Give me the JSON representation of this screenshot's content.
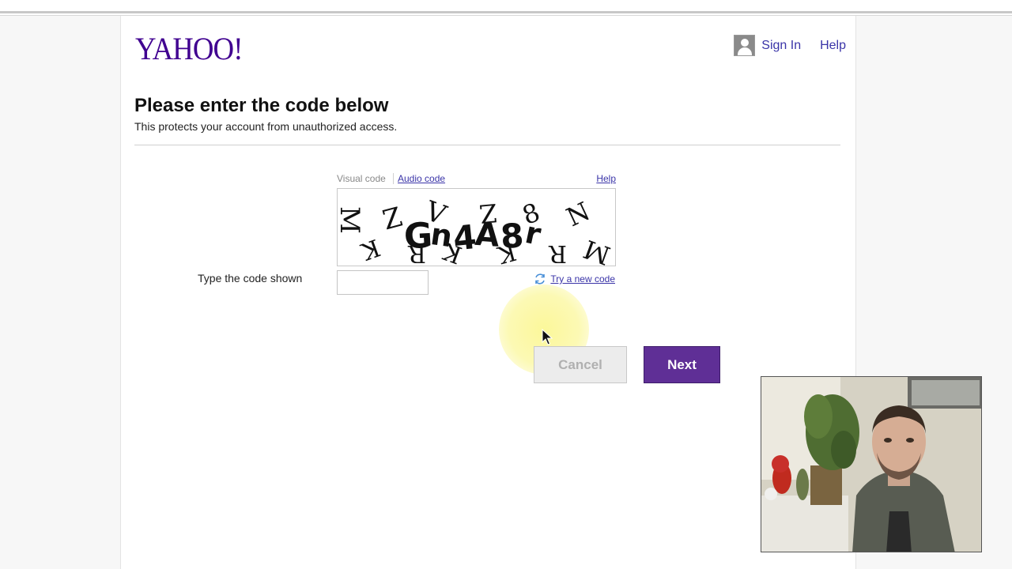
{
  "logo": {
    "text": "YAHOO!"
  },
  "header": {
    "sign_in": "Sign In",
    "help": "Help"
  },
  "main": {
    "title": "Please enter the code below",
    "subtitle": "This protects your account from unauthorized access."
  },
  "captcha": {
    "tab_visual": "Visual code",
    "tab_audio": "Audio code",
    "help": "Help",
    "code_label": "Type the code shown",
    "input_value": "",
    "try_new": "Try a new code"
  },
  "buttons": {
    "cancel": "Cancel",
    "next": "Next"
  },
  "colors": {
    "brand": "#400090",
    "link": "#3a34a8",
    "next_button": "#5f2f96"
  }
}
